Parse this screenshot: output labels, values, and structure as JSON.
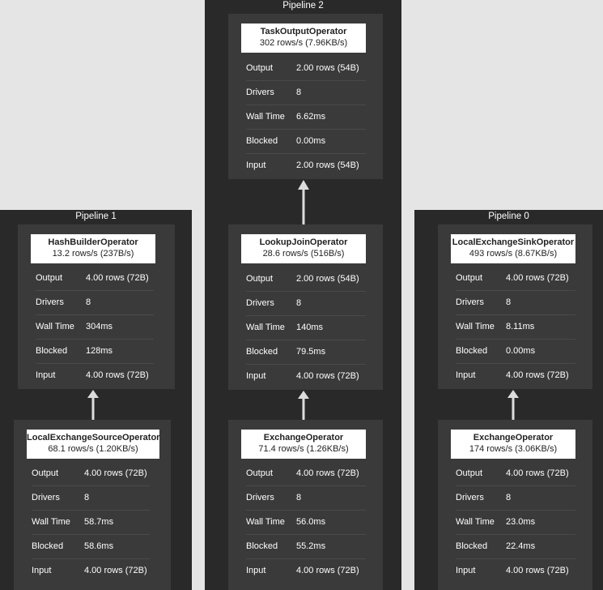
{
  "pipelines": {
    "p2": {
      "title": "Pipeline 2",
      "task_output": {
        "name": "TaskOutputOperator",
        "rate": "302 rows/s (7.96KB/s)",
        "output": "2.00 rows (54B)",
        "drivers": "8",
        "wall_time": "6.62ms",
        "blocked": "0.00ms",
        "input": "2.00 rows (54B)"
      },
      "lookup_join": {
        "name": "LookupJoinOperator",
        "rate": "28.6 rows/s (516B/s)",
        "output": "2.00 rows (54B)",
        "drivers": "8",
        "wall_time": "140ms",
        "blocked": "79.5ms",
        "input": "4.00 rows (72B)"
      },
      "exchange": {
        "name": "ExchangeOperator",
        "rate": "71.4 rows/s (1.26KB/s)",
        "output": "4.00 rows (72B)",
        "drivers": "8",
        "wall_time": "56.0ms",
        "blocked": "55.2ms",
        "input": "4.00 rows (72B)"
      }
    },
    "p1": {
      "title": "Pipeline 1",
      "hash_builder": {
        "name": "HashBuilderOperator",
        "rate": "13.2 rows/s (237B/s)",
        "output": "4.00 rows (72B)",
        "drivers": "8",
        "wall_time": "304ms",
        "blocked": "128ms",
        "input": "4.00 rows (72B)"
      },
      "local_exchange_source": {
        "name": "LocalExchangeSourceOperator",
        "rate": "68.1 rows/s (1.20KB/s)",
        "output": "4.00 rows (72B)",
        "drivers": "8",
        "wall_time": "58.7ms",
        "blocked": "58.6ms",
        "input": "4.00 rows (72B)"
      }
    },
    "p0": {
      "title": "Pipeline 0",
      "local_exchange_sink": {
        "name": "LocalExchangeSinkOperator",
        "rate": "493 rows/s (8.67KB/s)",
        "output": "4.00 rows (72B)",
        "drivers": "8",
        "wall_time": "8.11ms",
        "blocked": "0.00ms",
        "input": "4.00 rows (72B)"
      },
      "exchange": {
        "name": "ExchangeOperator",
        "rate": "174 rows/s (3.06KB/s)",
        "output": "4.00 rows (72B)",
        "drivers": "8",
        "wall_time": "23.0ms",
        "blocked": "22.4ms",
        "input": "4.00 rows (72B)"
      }
    }
  },
  "labels": {
    "output": "Output",
    "drivers": "Drivers",
    "wall_time": "Wall Time",
    "blocked": "Blocked",
    "input": "Input"
  },
  "colors": {
    "canvas": "#e5e5e5",
    "pipeline_bg": "#292929",
    "operator_bg": "#3a3a3a",
    "arrow": "#dcdcdc"
  }
}
